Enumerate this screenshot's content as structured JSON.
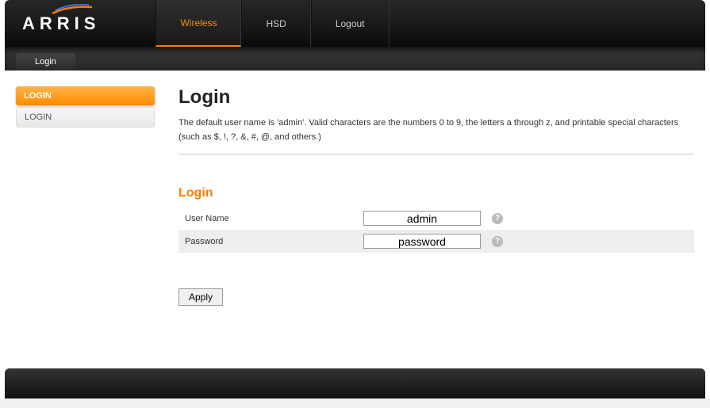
{
  "brand": "ARRIS",
  "nav": {
    "items": [
      {
        "label": "Wireless",
        "active": true
      },
      {
        "label": "HSD",
        "active": false
      },
      {
        "label": "Logout",
        "active": false
      }
    ]
  },
  "tabs": [
    {
      "label": "Login"
    }
  ],
  "sidebar": {
    "items": [
      {
        "label": "LOGIN",
        "active": true
      },
      {
        "label": "LOGIN",
        "active": false
      }
    ]
  },
  "main": {
    "title": "Login",
    "description": "The default user name is 'admin'. Valid characters are the numbers 0 to 9, the letters a through z, and printable special characters (such as $, !, ?, &, #, @, and others.)",
    "section_title": "Login",
    "fields": {
      "username": {
        "label": "User Name",
        "value": "admin"
      },
      "password": {
        "label": "Password",
        "value": "password"
      }
    },
    "apply_label": "Apply",
    "help_glyph": "?"
  }
}
